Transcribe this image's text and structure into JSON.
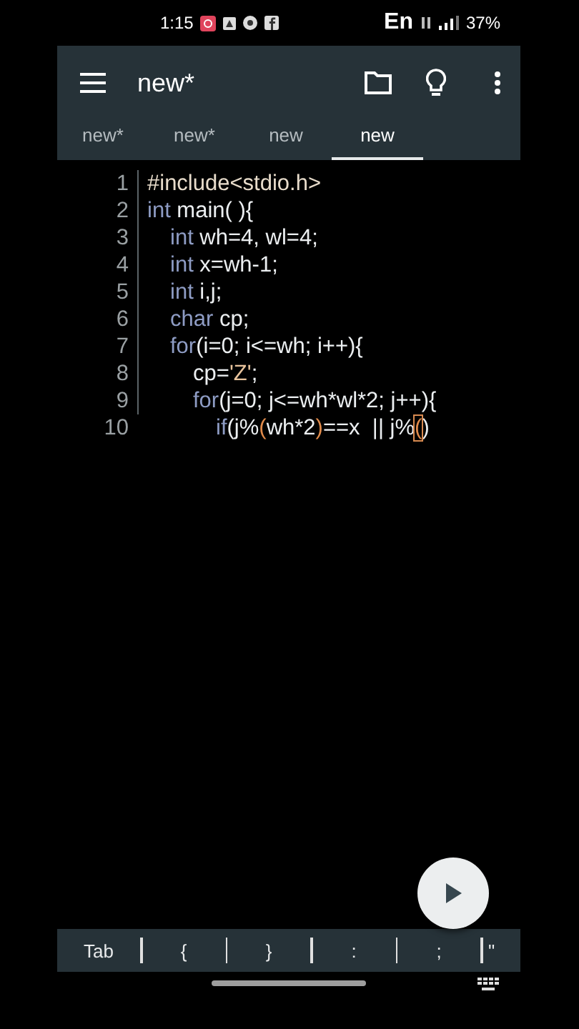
{
  "status_bar": {
    "time": "1:15",
    "language": "En",
    "battery": "37%"
  },
  "toolbar": {
    "title": "new*"
  },
  "tabs": [
    {
      "label": "new*",
      "selected": false
    },
    {
      "label": "new*",
      "selected": false
    },
    {
      "label": "new",
      "selected": false
    },
    {
      "label": "new",
      "selected": true
    }
  ],
  "editor": {
    "lines": [
      {
        "number": "1",
        "segments": [
          {
            "kind": "directive",
            "text": "#include<stdio.h>"
          }
        ]
      },
      {
        "number": "2",
        "segments": [
          {
            "kind": "keyword",
            "text": "int"
          },
          {
            "kind": "plain",
            "text": " main( ){"
          }
        ],
        "children": [
          {
            "number": "3",
            "segments": [
              {
                "kind": "keyword",
                "text": "int"
              },
              {
                "kind": "plain",
                "text": " wh=4, wl=4;"
              }
            ]
          },
          {
            "number": "4",
            "segments": [
              {
                "kind": "keyword",
                "text": "int"
              },
              {
                "kind": "plain",
                "text": " x=wh-1;"
              }
            ]
          },
          {
            "number": "5",
            "segments": [
              {
                "kind": "keyword",
                "text": "int"
              },
              {
                "kind": "plain",
                "text": " i,j;"
              }
            ]
          },
          {
            "number": "6",
            "segments": [
              {
                "kind": "keyword",
                "text": "char"
              },
              {
                "kind": "plain",
                "text": " cp;"
              }
            ]
          },
          {
            "number": "7",
            "segments": [
              {
                "kind": "keyword",
                "text": "for"
              },
              {
                "kind": "plain",
                "text": "(i=0; i<=wh; i++){"
              }
            ],
            "children": [
              {
                "number": "8",
                "segments": [
                  {
                    "kind": "plain",
                    "text": "cp="
                  },
                  {
                    "kind": "string",
                    "text": "'Z'"
                  },
                  {
                    "kind": "plain",
                    "text": ";"
                  }
                ]
              },
              {
                "number": "9",
                "segments": [
                  {
                    "kind": "keyword",
                    "text": "for"
                  },
                  {
                    "kind": "plain",
                    "text": "(j=0; j<=wh*wl*2; j++){"
                  }
                ],
                "children": [
                  {
                    "number": "10",
                    "segments": [
                      {
                        "kind": "keyword",
                        "text": "if"
                      },
                      {
                        "kind": "plain",
                        "text": "(j%"
                      },
                      {
                        "kind": "bracket",
                        "text": "("
                      },
                      {
                        "kind": "plain",
                        "text": "wh*2"
                      },
                      {
                        "kind": "bracket",
                        "text": ")"
                      },
                      {
                        "kind": "plain",
                        "text": "==x  || j%"
                      },
                      {
                        "kind": "cursor",
                        "text": "("
                      },
                      {
                        "kind": "plain",
                        "text": ")"
                      }
                    ]
                  }
                ]
              }
            ]
          }
        ]
      }
    ]
  },
  "key_bar": {
    "keys": [
      "Tab",
      "{",
      "}",
      ":",
      ";",
      "\""
    ]
  }
}
